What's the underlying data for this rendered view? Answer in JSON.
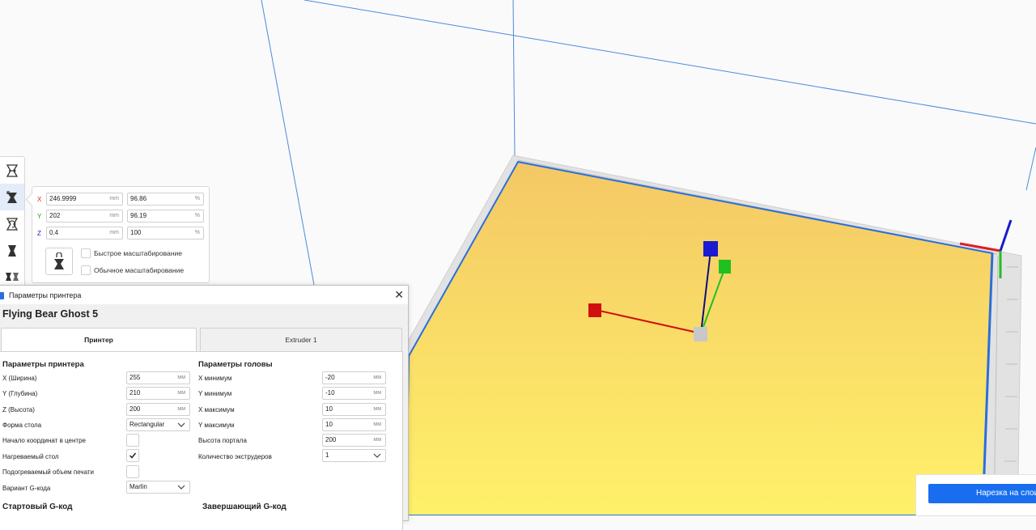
{
  "colors": {
    "accent": "#196ef0",
    "axis_x": "#e02020",
    "axis_y": "#20c020",
    "axis_z": "#1a1ad0",
    "build_plate": "#fde56a",
    "plate_border": "#2a6fdb",
    "volume_lines": "#4a8ae0"
  },
  "toolbar": {
    "tools": [
      {
        "icon": "move-tool-icon"
      },
      {
        "icon": "scale-tool-icon",
        "active": true
      },
      {
        "icon": "rotate-tool-icon"
      },
      {
        "icon": "mirror-tool-icon"
      },
      {
        "icon": "per-model-settings-icon"
      }
    ]
  },
  "scale_panel": {
    "x": {
      "label": "X",
      "mm": "246.9999",
      "mm_unit": "mm",
      "pct": "96.86",
      "pct_unit": "%"
    },
    "y": {
      "label": "Y",
      "mm": "202",
      "mm_unit": "mm",
      "pct": "96.19",
      "pct_unit": "%"
    },
    "z": {
      "label": "Z",
      "mm": "0.4",
      "mm_unit": "mm",
      "pct": "100",
      "pct_unit": "%"
    },
    "snap_scaling": "Быстрое масштабирование",
    "uniform_scaling": "Обычное масштабирование"
  },
  "dialog": {
    "title": "Параметры принтера",
    "machine_name": "Flying Bear Ghost 5",
    "tabs": [
      "Принтер",
      "Extruder 1"
    ],
    "printer_section": {
      "title": "Параметры принтера",
      "width_label": "X (Ширина)",
      "width_value": "255",
      "width_unit": "мм",
      "depth_label": "Y (Глубина)",
      "depth_value": "210",
      "depth_unit": "мм",
      "height_label": "Z (Высота)",
      "height_value": "200",
      "height_unit": "мм",
      "bed_shape_label": "Форма стола",
      "bed_shape_value": "Rectangular",
      "origin_center_label": "Начало координат в центре",
      "heated_bed_label": "Нагреваемый стол",
      "heated_volume_label": "Подогреваемый объем печати",
      "gcode_flavor_label": "Вариант G-кода",
      "gcode_flavor_value": "Marlin"
    },
    "head_section": {
      "title": "Параметры головы",
      "xmin_label": "X минимум",
      "xmin_value": "-20",
      "xmin_unit": "мм",
      "ymin_label": "Y минимум",
      "ymin_value": "-10",
      "ymin_unit": "мм",
      "xmax_label": "X максимум",
      "xmax_value": "10",
      "xmax_unit": "мм",
      "ymax_label": "Y максимум",
      "ymax_value": "10",
      "ymax_unit": "мм",
      "gantry_label": "Высота портала",
      "gantry_value": "200",
      "gantry_unit": "мм",
      "extruders_label": "Количество экструдеров",
      "extruders_value": "1"
    },
    "start_gcode_title": "Стартовый G-код",
    "end_gcode_title": "Завершающий G-код"
  },
  "slice_button": {
    "label": "Нарезка на слои"
  }
}
